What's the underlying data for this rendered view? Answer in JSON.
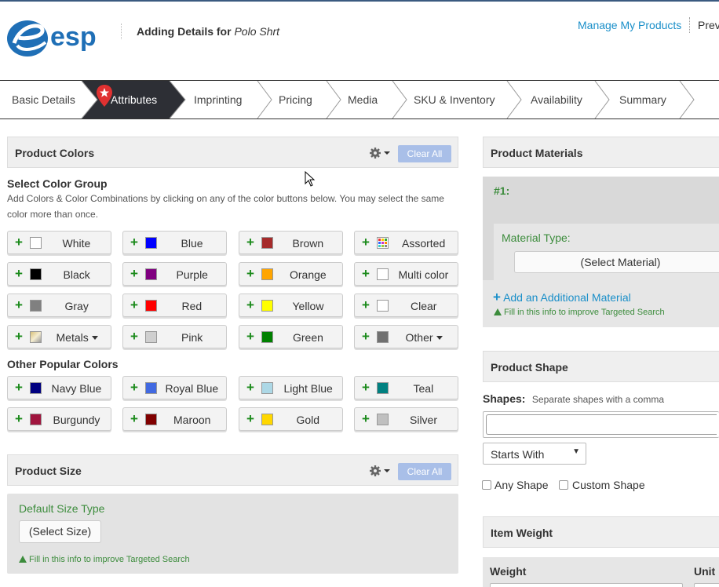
{
  "header": {
    "logo_text": "esp",
    "title_prefix": "Adding Details for",
    "product_name": "Polo Shrt",
    "manage_link": "Manage My Products",
    "preview_link": "Prev"
  },
  "steps": [
    {
      "label": "Basic Details",
      "active": false
    },
    {
      "label": "Attributes",
      "active": true
    },
    {
      "label": "Imprinting",
      "active": false
    },
    {
      "label": "Pricing",
      "active": false
    },
    {
      "label": "Media",
      "active": false
    },
    {
      "label": "SKU & Inventory",
      "active": false
    },
    {
      "label": "Availability",
      "active": false
    },
    {
      "label": "Summary",
      "active": false
    }
  ],
  "product_colors": {
    "title": "Product Colors",
    "clear_all": "Clear All",
    "select_group_label": "Select Color Group",
    "help_text": "Add Colors & Color Combinations by clicking on any of the color buttons below. You may select the same color more than once.",
    "color_groups": [
      {
        "label": "White",
        "swatch": "#ffffff"
      },
      {
        "label": "Blue",
        "swatch": "#0000ff"
      },
      {
        "label": "Brown",
        "swatch": "#a52a2a"
      },
      {
        "label": "Assorted",
        "swatch": "multi"
      },
      {
        "label": "Black",
        "swatch": "#000000"
      },
      {
        "label": "Purple",
        "swatch": "#800080"
      },
      {
        "label": "Orange",
        "swatch": "#ffa500"
      },
      {
        "label": "Multi color",
        "swatch": "#ffffff"
      },
      {
        "label": "Gray",
        "swatch": "#808080"
      },
      {
        "label": "Red",
        "swatch": "#ff0000"
      },
      {
        "label": "Yellow",
        "swatch": "#ffff00"
      },
      {
        "label": "Clear",
        "swatch": "#ffffff"
      },
      {
        "label": "Metals",
        "swatch": "metal",
        "dropdown": true
      },
      {
        "label": "Pink",
        "swatch": "#cfcfcf"
      },
      {
        "label": "Green",
        "swatch": "#008000"
      },
      {
        "label": "Other",
        "swatch": "#707070",
        "dropdown": true
      }
    ],
    "popular_label": "Other Popular Colors",
    "popular_colors": [
      {
        "label": "Navy Blue",
        "swatch": "#000080"
      },
      {
        "label": "Royal Blue",
        "swatch": "#4169e1"
      },
      {
        "label": "Light Blue",
        "swatch": "#add8e6"
      },
      {
        "label": "Teal",
        "swatch": "#008080"
      },
      {
        "label": "Burgundy",
        "swatch": "#a0153e"
      },
      {
        "label": "Maroon",
        "swatch": "#800000"
      },
      {
        "label": "Gold",
        "swatch": "#ffd700"
      },
      {
        "label": "Silver",
        "swatch": "#c0c0c0"
      }
    ]
  },
  "product_size": {
    "title": "Product Size",
    "clear_all": "Clear All",
    "default_type_label": "Default Size Type",
    "select_size": "(Select Size)",
    "tip": "Fill in this info to improve Targeted Search"
  },
  "product_materials": {
    "title": "Product Materials",
    "item_number": "#1:",
    "material_type_label": "Material Type:",
    "select_material": "(Select Material)",
    "add_link": "Add an Additional Material",
    "tip": "Fill in this info to improve Targeted Search"
  },
  "product_shape": {
    "title": "Product Shape",
    "shapes_label": "Shapes:",
    "shapes_hint": "Separate shapes with a comma",
    "shapes_value": "",
    "match_mode": "Starts With",
    "any_shape": "Any Shape",
    "custom_shape": "Custom Shape"
  },
  "item_weight": {
    "title": "Item Weight",
    "weight_label": "Weight",
    "unit_label": "Unit"
  },
  "colors": {
    "accent": "#1a8fc9",
    "green": "#3c8c3c",
    "plus_green": "#1b8a1b",
    "clear_all_bg": "#a9bfe8",
    "active_step_bg": "#2d2f35"
  }
}
